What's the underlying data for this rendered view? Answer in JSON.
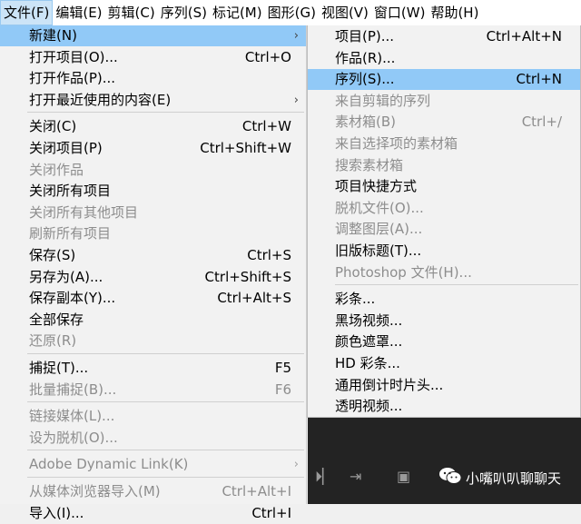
{
  "menubar": [
    {
      "label": "文件(F)",
      "active": true
    },
    {
      "label": "编辑(E)"
    },
    {
      "label": "剪辑(C)"
    },
    {
      "label": "序列(S)"
    },
    {
      "label": "标记(M)"
    },
    {
      "label": "图形(G)"
    },
    {
      "label": "视图(V)"
    },
    {
      "label": "窗口(W)"
    },
    {
      "label": "帮助(H)"
    }
  ],
  "file_menu": [
    {
      "label": "新建(N)",
      "submenu": true,
      "highlighted": true
    },
    {
      "label": "打开项目(O)...",
      "shortcut": "Ctrl+O"
    },
    {
      "label": "打开作品(P)..."
    },
    {
      "label": "打开最近使用的内容(E)",
      "submenu": true
    },
    {
      "separator": true
    },
    {
      "label": "关闭(C)",
      "shortcut": "Ctrl+W"
    },
    {
      "label": "关闭项目(P)",
      "shortcut": "Ctrl+Shift+W"
    },
    {
      "label": "关闭作品",
      "disabled": true
    },
    {
      "label": "关闭所有项目"
    },
    {
      "label": "关闭所有其他项目",
      "disabled": true
    },
    {
      "label": "刷新所有项目",
      "disabled": true
    },
    {
      "label": "保存(S)",
      "shortcut": "Ctrl+S"
    },
    {
      "label": "另存为(A)...",
      "shortcut": "Ctrl+Shift+S"
    },
    {
      "label": "保存副本(Y)...",
      "shortcut": "Ctrl+Alt+S"
    },
    {
      "label": "全部保存"
    },
    {
      "label": "还原(R)",
      "disabled": true
    },
    {
      "separator": true
    },
    {
      "label": "捕捉(T)...",
      "shortcut": "F5"
    },
    {
      "label": "批量捕捉(B)...",
      "shortcut": "F6",
      "disabled": true
    },
    {
      "separator": true
    },
    {
      "label": "链接媒体(L)...",
      "disabled": true
    },
    {
      "label": "设为脱机(O)...",
      "disabled": true
    },
    {
      "separator": true
    },
    {
      "label": "Adobe Dynamic Link(K)",
      "submenu": true,
      "disabled": true
    },
    {
      "separator": true
    },
    {
      "label": "从媒体浏览器导入(M)",
      "shortcut": "Ctrl+Alt+I",
      "disabled": true
    },
    {
      "label": "导入(I)...",
      "shortcut": "Ctrl+I"
    }
  ],
  "new_submenu": [
    {
      "label": "项目(P)...",
      "shortcut": "Ctrl+Alt+N"
    },
    {
      "label": "作品(R)..."
    },
    {
      "label": "序列(S)...",
      "shortcut": "Ctrl+N",
      "highlighted": true
    },
    {
      "label": "来自剪辑的序列",
      "disabled": true
    },
    {
      "label": "素材箱(B)",
      "shortcut": "Ctrl+/",
      "disabled": true
    },
    {
      "label": "来自选择项的素材箱",
      "disabled": true
    },
    {
      "label": "搜索素材箱",
      "disabled": true
    },
    {
      "label": "项目快捷方式"
    },
    {
      "label": "脱机文件(O)...",
      "disabled": true
    },
    {
      "label": "调整图层(A)...",
      "disabled": true
    },
    {
      "label": "旧版标题(T)..."
    },
    {
      "label": "Photoshop 文件(H)...",
      "disabled": true
    },
    {
      "separator": true
    },
    {
      "label": "彩条..."
    },
    {
      "label": "黑场视频..."
    },
    {
      "label": "颜色遮罩..."
    },
    {
      "label": "HD 彩条..."
    },
    {
      "label": "通用倒计时片头..."
    },
    {
      "label": "透明视频..."
    }
  ],
  "watermark": {
    "text": "小嘴叭叭聊聊天",
    "icon": "wechat-icon"
  },
  "toolbar_icons": [
    "step-forward-icon",
    "insert-icon",
    "export-frame-icon"
  ],
  "colors": {
    "highlight": "#91c9f7",
    "menubar_active": "#cce4f7",
    "panel": "#232323"
  }
}
